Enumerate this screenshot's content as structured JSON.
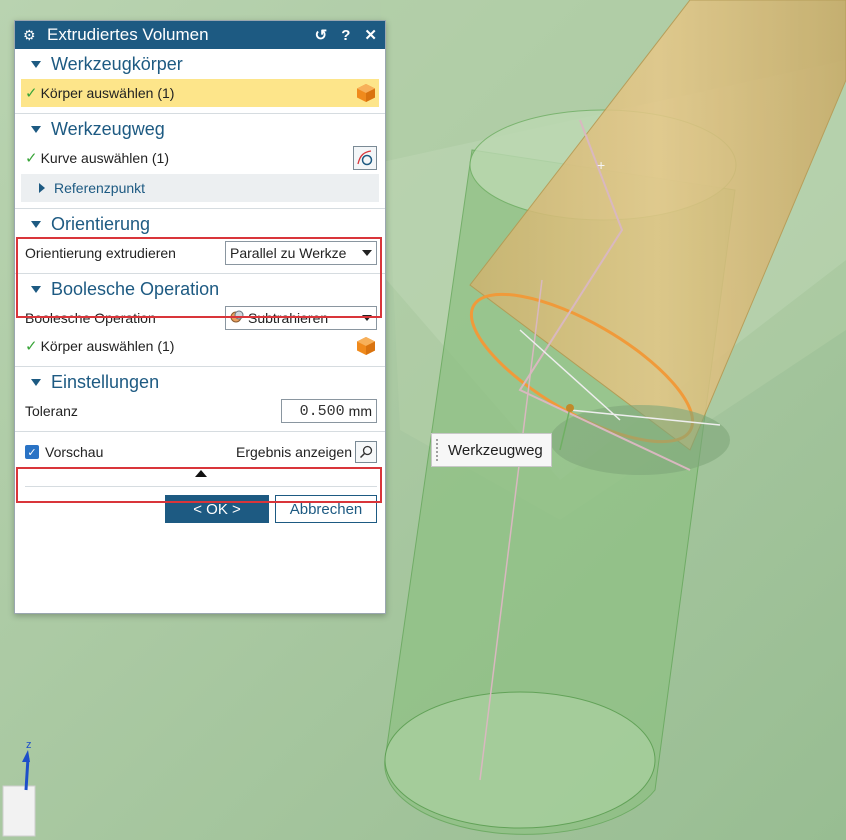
{
  "dialog": {
    "title": "Extrudiertes Volumen",
    "sections": {
      "werkzeugkoerper": {
        "title": "Werkzeugkörper",
        "select_label": "Körper auswählen (1)"
      },
      "werkzeugweg": {
        "title": "Werkzeugweg",
        "select_label": "Kurve auswählen (1)",
        "sub_label": "Referenzpunkt"
      },
      "orientierung": {
        "title": "Orientierung",
        "field_label": "Orientierung extrudieren",
        "field_value": "Parallel zu Werkze"
      },
      "boolesche": {
        "title": "Boolesche Operation",
        "field_label": "Boolesche Operation",
        "field_value": "Subtrahieren",
        "select_label": "Körper auswählen (1)"
      },
      "einstellungen": {
        "title": "Einstellungen",
        "field_label": "Toleranz",
        "field_value": "0.500",
        "unit": "mm"
      }
    },
    "preview_label": "Vorschau",
    "result_label": "Ergebnis anzeigen",
    "ok_label": "< OK >",
    "cancel_label": "Abbrechen"
  },
  "viewport": {
    "tooltip": "Werkzeugweg",
    "axis_label": "z"
  },
  "colors": {
    "titlebar": "#1d5a82",
    "accent": "#1d5a82",
    "highlight_row": "#fde58a",
    "red_outline": "#d9353a",
    "cube_orange": "#f08a1c",
    "viewport_green": "#a8c7a0"
  },
  "icons": [
    "gear-icon",
    "reset-icon",
    "help-icon",
    "close-icon",
    "check-icon",
    "cube-icon",
    "curve-icon",
    "search-icon",
    "subtract-icon",
    "triad-icon"
  ]
}
